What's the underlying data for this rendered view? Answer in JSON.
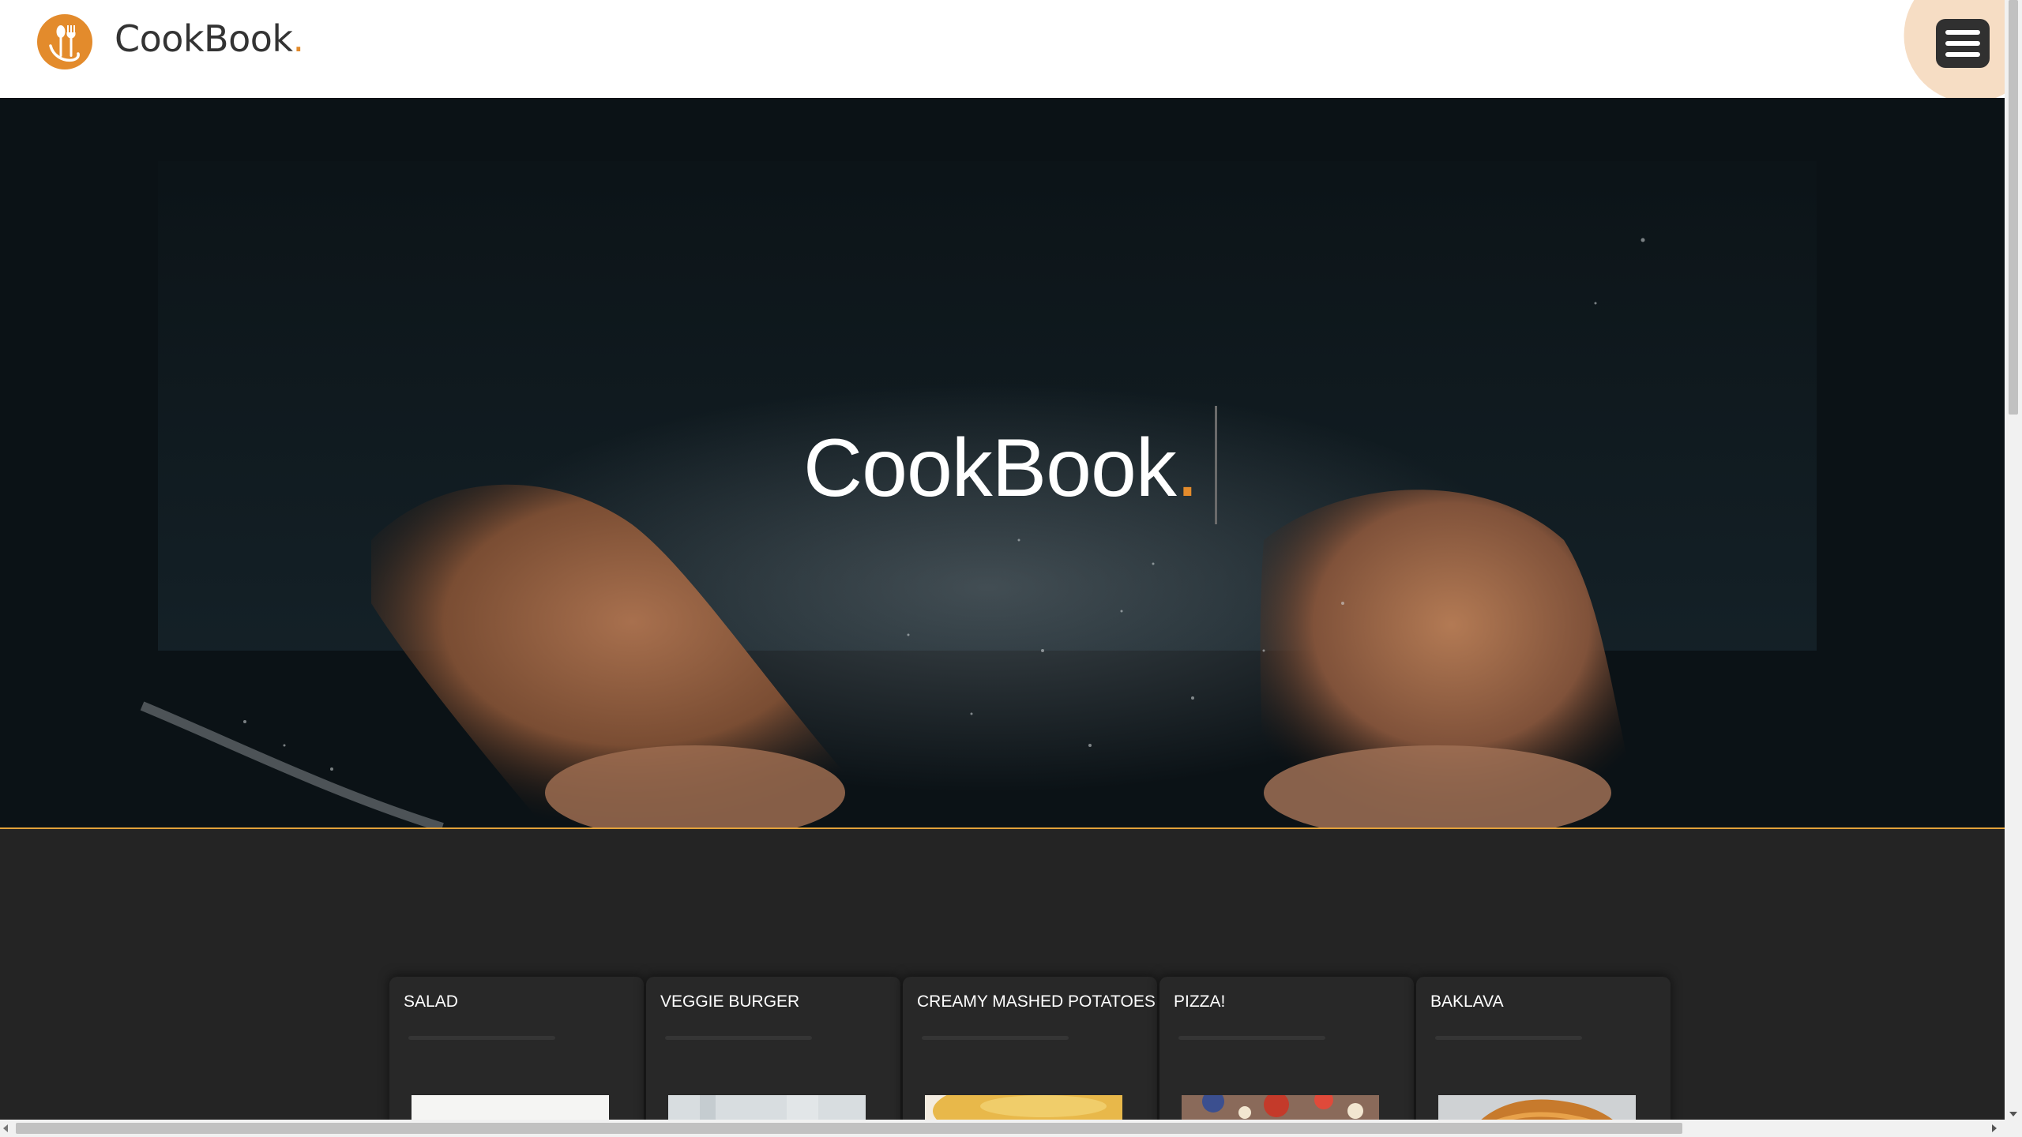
{
  "header": {
    "logo_text": "CookBook",
    "logo_dot": ".",
    "logo_icon": "fork-spoon-icon",
    "menu_icon": "hamburger-menu-icon"
  },
  "hero": {
    "title": "CookBook",
    "title_dot": "."
  },
  "cards": [
    {
      "title": "SALAD"
    },
    {
      "title": "VEGGIE BURGER"
    },
    {
      "title": "CREAMY MASHED POTATOES"
    },
    {
      "title": "PIZZA!"
    },
    {
      "title": "BAKLAVA"
    }
  ],
  "colors": {
    "accent": "#e38b2c",
    "menu_blob": "#f6ddc4",
    "dark_background": "#242424",
    "card_background": "#282828",
    "hero_border": "#e3a23b"
  }
}
